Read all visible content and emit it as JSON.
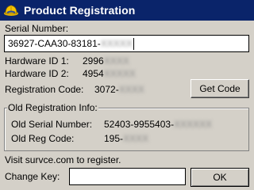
{
  "window": {
    "title": "Product Registration"
  },
  "serial": {
    "label": "Serial Number:",
    "value_visible": "36927-CAA30-83181-",
    "value_masked": "XXXXX"
  },
  "hardware": {
    "id1_label": "Hardware ID 1:",
    "id1_visible": "2996",
    "id1_masked": "XXXX",
    "id2_label": "Hardware ID 2:",
    "id2_visible": "4954",
    "id2_masked": "XXXXX"
  },
  "registration": {
    "label": "Registration Code:",
    "visible": "3072-",
    "masked": "XXXX",
    "get_code_label": "Get Code"
  },
  "old_info": {
    "legend": "Old Registration Info:",
    "serial_label": "Old Serial Number:",
    "serial_visible": "52403-9955403-",
    "serial_masked": "XXXXXX",
    "reg_label": "Old Reg Code:",
    "reg_visible": "195-",
    "reg_masked": "XXXX"
  },
  "footer": {
    "visit_text": "Visit survce.com to register.",
    "change_key_label": "Change Key:",
    "change_key_value": "",
    "ok_label": "OK"
  },
  "colors": {
    "titlebar": "#0a246a",
    "window_bg": "#d4d0c8"
  },
  "icons": {
    "app": "construction-helmet-icon"
  }
}
